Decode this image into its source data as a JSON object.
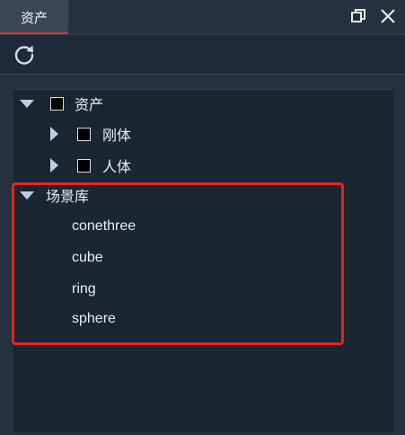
{
  "tab": {
    "label": "资产"
  },
  "colors": {
    "accent": "#d33a3a",
    "highlight": "#e3251c",
    "panel_bg": "#1b2633"
  },
  "icons": [
    "restore-window-icon",
    "close-icon",
    "refresh-icon",
    "expand-triangle-icon",
    "collapse-triangle-icon"
  ],
  "tree": {
    "assets": {
      "label": "资产"
    },
    "rigid_body": {
      "label": "刚体"
    },
    "human_body": {
      "label": "人体"
    },
    "scene_library": {
      "label": "场景库",
      "items": [
        "conethree",
        "cube",
        "ring",
        "sphere"
      ]
    }
  }
}
